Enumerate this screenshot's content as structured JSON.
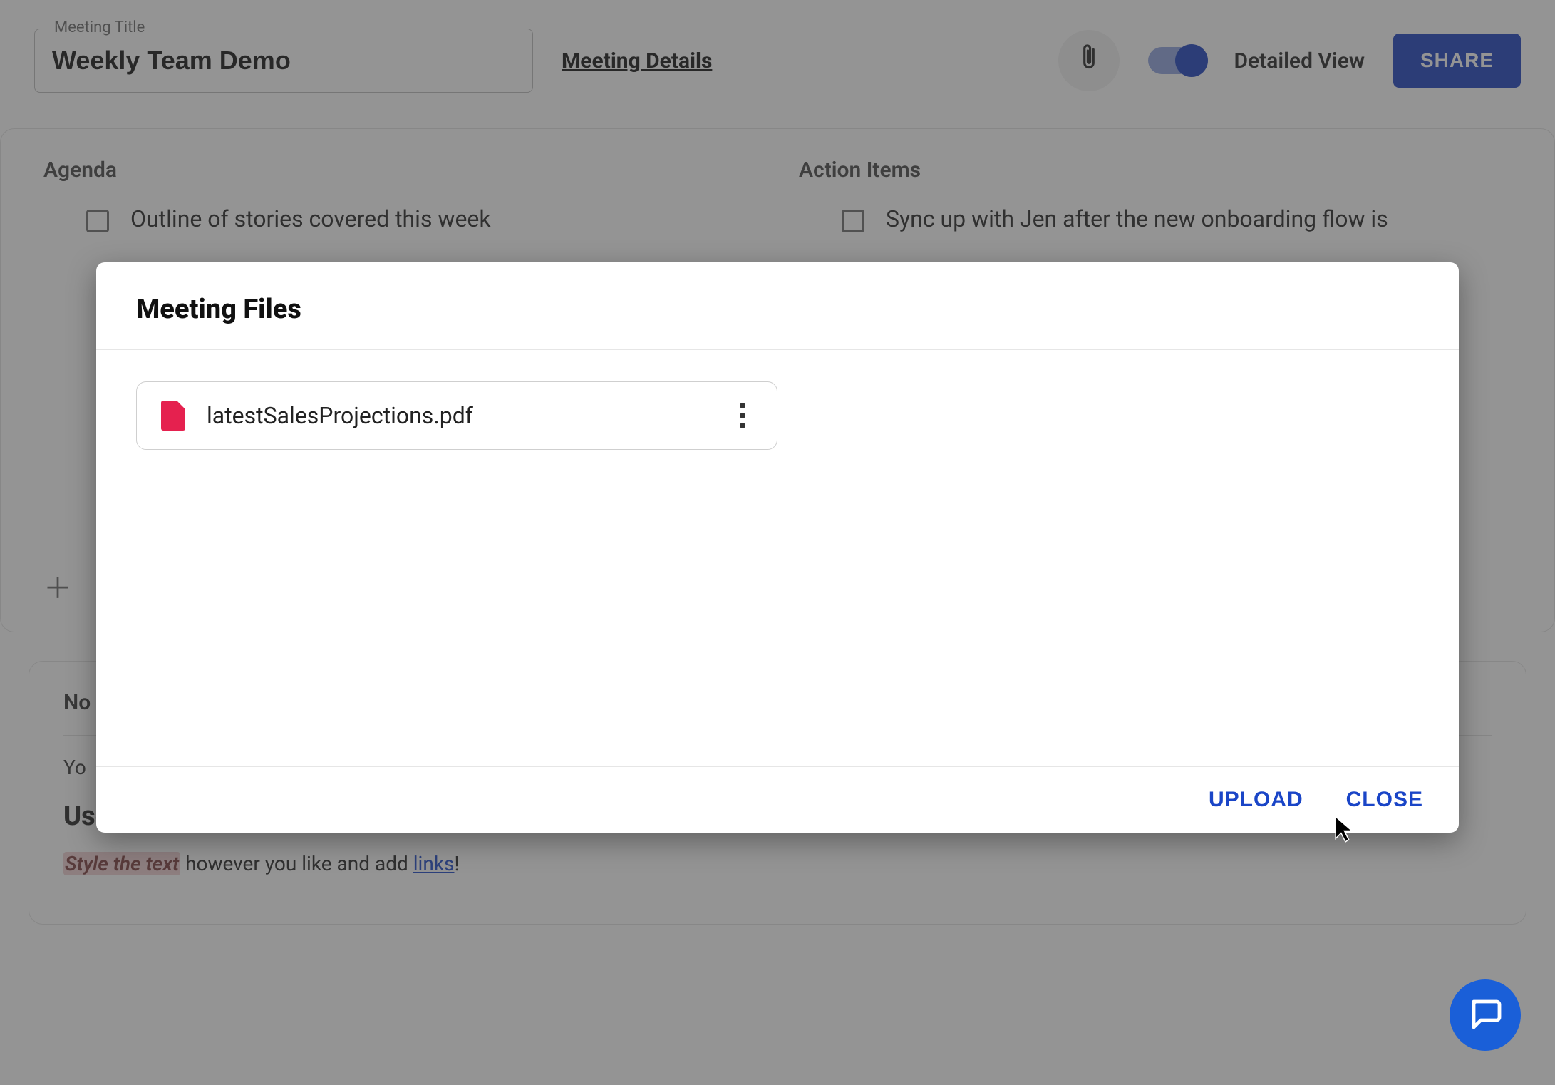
{
  "header": {
    "title_label": "Meeting Title",
    "title_value": "Weekly Team Demo",
    "details_link": "Meeting Details",
    "toggle_label": "Detailed View",
    "share_label": "SHARE"
  },
  "agenda": {
    "heading": "Agenda",
    "items": [
      {
        "text": "Outline of stories covered this week"
      }
    ]
  },
  "action_items": {
    "heading": "Action Items",
    "items": [
      {
        "text": "Sync up with Jen after the new onboarding flow is"
      }
    ]
  },
  "notes": {
    "heading_prefix": "No",
    "hint_prefix": "Yo",
    "big_heading": "Use headings for agenda items or important points.",
    "styled_span": "Style the text",
    "rest_line": " however you like and add ",
    "link_text": "links",
    "trailing": "!"
  },
  "modal": {
    "title": "Meeting Files",
    "files": [
      {
        "name": "latestSalesProjections.pdf"
      }
    ],
    "upload_label": "UPLOAD",
    "close_label": "CLOSE"
  }
}
